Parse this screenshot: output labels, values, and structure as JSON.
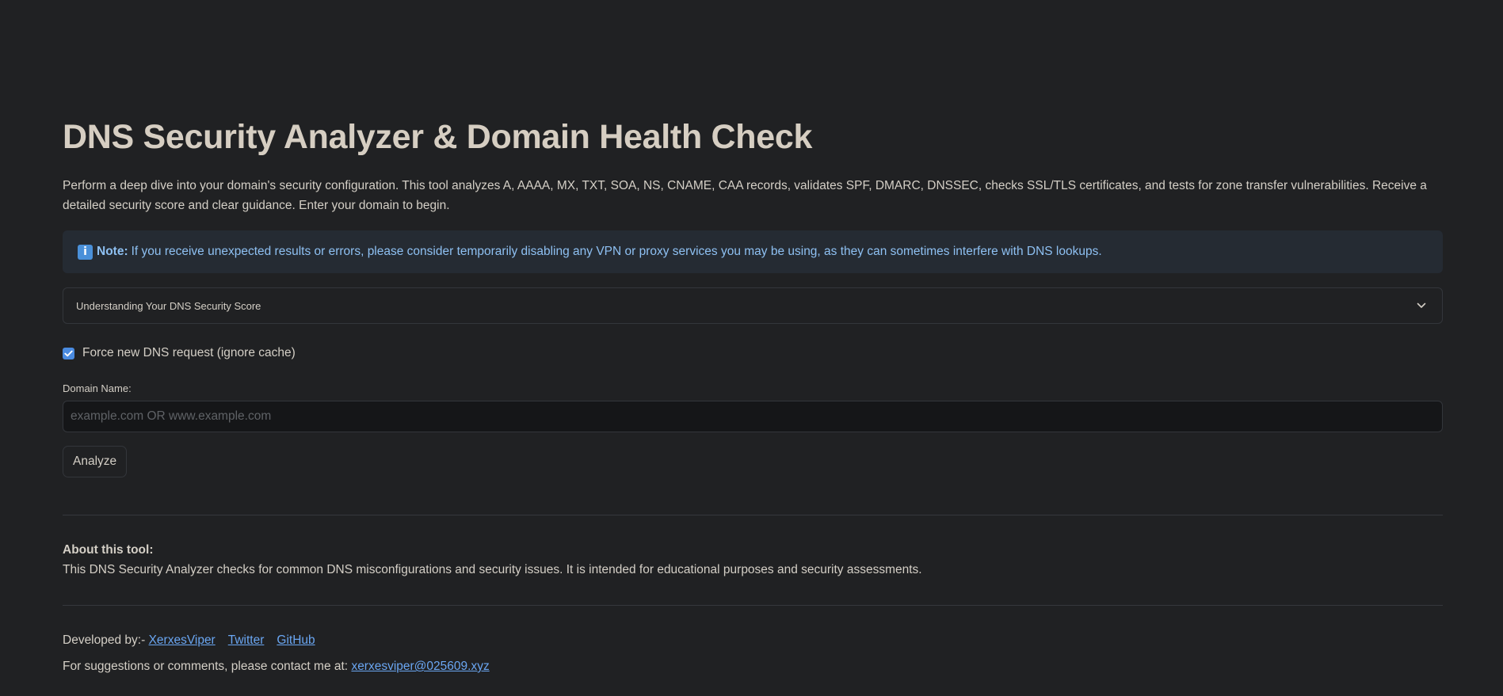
{
  "header": {
    "title": "DNS Security Analyzer & Domain Health Check",
    "intro": "Perform a deep dive into your domain's security configuration. This tool analyzes A, AAAA, MX, TXT, SOA, NS, CNAME, CAA records, validates SPF, DMARC, DNSSEC, checks SSL/TLS certificates, and tests for zone transfer vulnerabilities. Receive a detailed security score and clear guidance. Enter your domain to begin."
  },
  "note": {
    "icon": "info-icon",
    "icon_glyph": "i",
    "label": "Note:",
    "text": "If you receive unexpected results or errors, please consider temporarily disabling any VPN or proxy services you may be using, as they can sometimes interfere with DNS lookups."
  },
  "expander": {
    "label": "Understanding Your DNS Security Score",
    "icon": "chevron-down-icon"
  },
  "form": {
    "force_checkbox_label": "Force new DNS request (ignore cache)",
    "force_checked": true,
    "domain_label": "Domain Name:",
    "domain_value": "",
    "domain_placeholder": "example.com OR www.example.com",
    "analyze_label": "Analyze"
  },
  "about": {
    "title": "About this tool:",
    "text": "This DNS Security Analyzer checks for common DNS misconfigurations and security issues. It is intended for educational purposes and security assessments."
  },
  "footer": {
    "developed_by_prefix": "Developed by:-",
    "author_link": "XerxesViper",
    "twitter_link": "Twitter",
    "github_link": "GitHub",
    "contact_prefix": "For suggestions or comments, please contact me at:",
    "contact_email": "xerxesviper@025609.xyz"
  },
  "colors": {
    "background": "#202123",
    "note_background": "#252b33",
    "note_text": "#8ec0f2",
    "accent": "#4a8be0",
    "link": "#6aa6f2"
  }
}
